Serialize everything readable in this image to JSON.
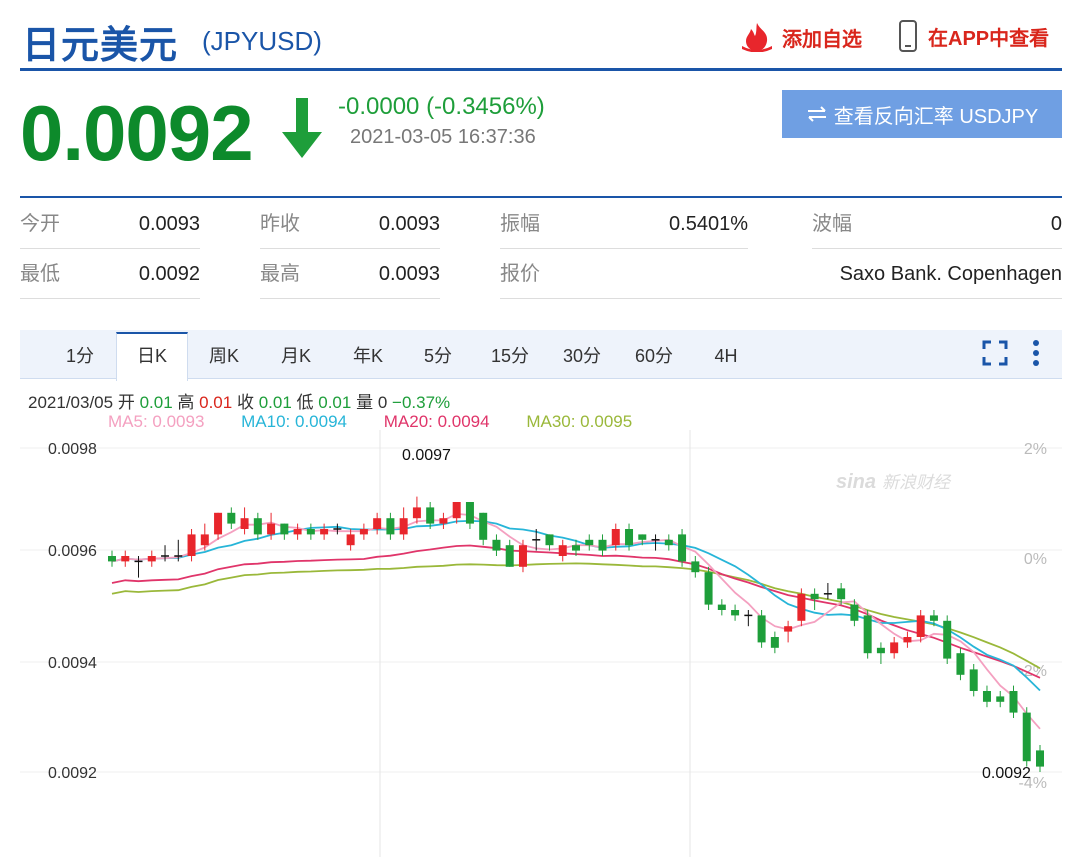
{
  "header": {
    "title": "日元美元",
    "code": "(JPYUSD)",
    "add_favorite": "添加自选",
    "view_in_app": "在APP中查看"
  },
  "quote": {
    "price": "0.0092",
    "change": "-0.0000 (-0.3456%)",
    "datetime": "2021-03-05 16:37:36",
    "reverse_button": "查看反向汇率 USDJPY",
    "direction": "down",
    "down_color": "#0d8a2b"
  },
  "stats": {
    "open_label": "今开",
    "open_value": "0.0093",
    "prev_close_label": "昨收",
    "prev_close_value": "0.0093",
    "amplitude_label": "振幅",
    "amplitude_value": "0.5401%",
    "wave_label": "波幅",
    "wave_value": "0",
    "low_label": "最低",
    "low_value": "0.0092",
    "high_label": "最高",
    "high_value": "0.0093",
    "quote_label": "报价",
    "quote_value": "Saxo Bank. Copenhagen"
  },
  "tabs": [
    "1分",
    "日K",
    "周K",
    "月K",
    "年K",
    "5分",
    "15分",
    "30分",
    "60分",
    "4H"
  ],
  "active_tab": "日K",
  "ohlc_line": {
    "date": "2021/03/05",
    "open_label": "开",
    "open": "0.01",
    "high_label": "高",
    "high": "0.01",
    "close_label": "收",
    "close": "0.01",
    "low_label": "低",
    "low": "0.01",
    "volume_label": "量",
    "volume": "0",
    "change_pct": "−0.37%"
  },
  "ma": {
    "ma5": "MA5: 0.0093",
    "ma10": "MA10: 0.0094",
    "ma20": "MA20: 0.0094",
    "ma30": "MA30: 0.0095",
    "colors": {
      "ma5": "#f4a0c0",
      "ma10": "#27b5d8",
      "ma20": "#e0356a",
      "ma30": "#9ab83a"
    }
  },
  "axis": {
    "left_ticks": [
      "0.0098",
      "0.0096",
      "0.0094",
      "0.0092"
    ],
    "right_ticks": [
      "2%",
      "0%",
      "-2%",
      "-4%"
    ],
    "high_label": "0.0097",
    "low_label": "0.0092",
    "watermark": "新浪财经",
    "watermark_logo": "sina"
  },
  "colors": {
    "up": "#e8262c",
    "down": "#1e9e3a",
    "brand": "#1a55a8",
    "button": "#6f9fe3"
  }
}
